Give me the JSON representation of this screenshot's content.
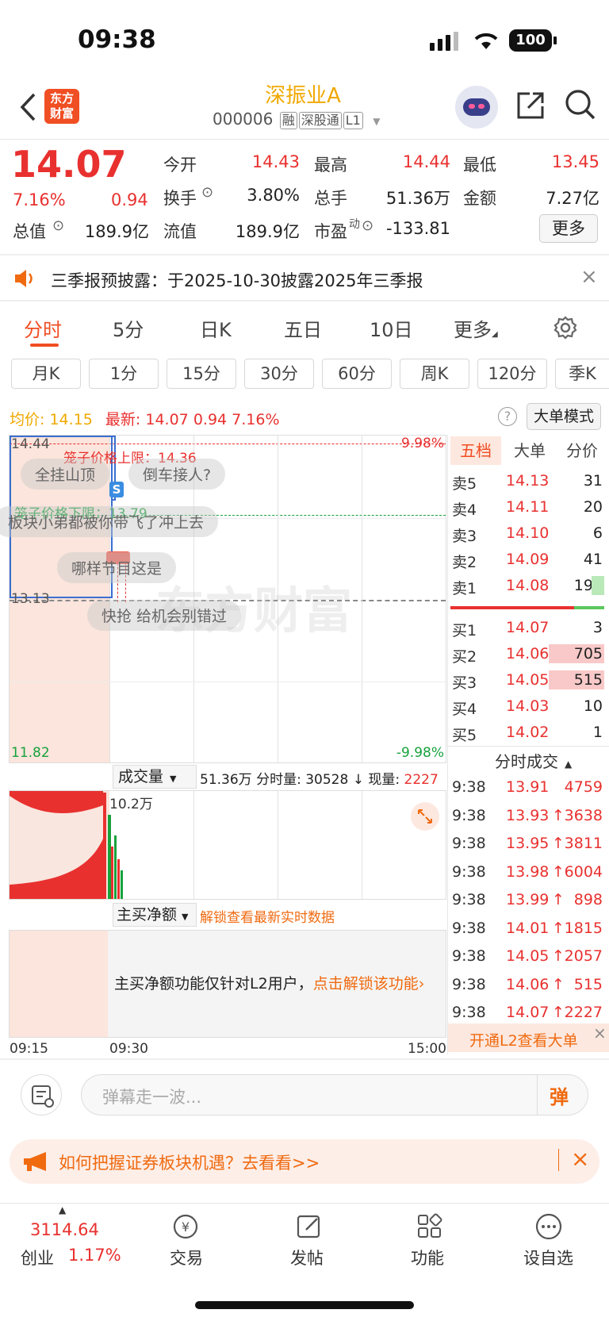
{
  "status": {
    "time": "09:38",
    "battery": "100"
  },
  "header": {
    "logo_line1": "东方",
    "logo_line2": "财富",
    "title": "深振业A",
    "code": "000006",
    "tags": [
      "融",
      "深股通",
      "L1"
    ]
  },
  "quote": {
    "price": "14.07",
    "pct": "7.16%",
    "change": "0.94",
    "rows": [
      [
        {
          "label": "今开",
          "value": "14.43",
          "color": "red"
        },
        {
          "label": "最高",
          "value": "14.44",
          "color": "red"
        },
        {
          "label": "最低",
          "value": "13.45",
          "color": "red"
        }
      ],
      [
        {
          "label": "换手",
          "value": "3.80%",
          "color": "dark"
        },
        {
          "label": "总手",
          "value": "51.36万",
          "color": "dark"
        },
        {
          "label": "金额",
          "value": "7.27亿",
          "color": "dark"
        }
      ]
    ],
    "row3": {
      "total_label": "总值",
      "total": "189.9亿",
      "float_label": "流值",
      "float": "189.9亿",
      "pe_label": "市盈",
      "pe_sup": "动",
      "pe": "-133.81"
    },
    "more": "更多"
  },
  "notice": {
    "text": "三季报预披露：于2025-10-30披露2025年三季报"
  },
  "tabs": [
    "分时",
    "5分",
    "日K",
    "五日",
    "10日",
    "更多"
  ],
  "ktabs": [
    "月K",
    "1分",
    "15分",
    "30分",
    "60分",
    "周K",
    "120分",
    "季K"
  ],
  "chartinfo": {
    "avg_label": "均价:",
    "avg": "14.15",
    "latest_label": "最新:",
    "latest": "14.07",
    "chg": "0.94",
    "pct": "7.16%",
    "bigorder": "大单模式"
  },
  "chart": {
    "high": "14.44",
    "mid": "13.13",
    "low": "11.82",
    "up_pct": "9.98%",
    "down_pct": "-9.98%",
    "cage_up": "笼子价格上限：14.36",
    "cage_down": "笼子价格下限：13.79",
    "watermark": "东方财富",
    "s_badge": "S"
  },
  "danmu": [
    "全挂山顶",
    "倒车接人?",
    "板块小弟都被你带飞了冲上去",
    "哪样节目这是",
    "快抢  给机会别错过"
  ],
  "volume": {
    "label": "成交量",
    "summary_a": "51.36万 分时量: 30528",
    "arrow": "↓",
    "summary_b": "现量:",
    "now": "2227",
    "peak": "10.2万"
  },
  "netbuy": {
    "label": "主买净额",
    "unlock": "解锁查看最新实时数据",
    "msg": "主买净额功能仅针对L2用户，",
    "link": "点击解锁该功能"
  },
  "timeaxis": [
    "09:15",
    "09:30",
    "15:00"
  ],
  "orderbook": {
    "tabs": [
      "五档",
      "大单",
      "分价"
    ],
    "asks": [
      {
        "label": "卖5",
        "price": "14.13",
        "vol": "31"
      },
      {
        "label": "卖4",
        "price": "14.11",
        "vol": "20"
      },
      {
        "label": "卖3",
        "price": "14.10",
        "vol": "6"
      },
      {
        "label": "卖2",
        "price": "14.09",
        "vol": "41"
      },
      {
        "label": "卖1",
        "price": "14.08",
        "vol": "199"
      }
    ],
    "bids": [
      {
        "label": "买1",
        "price": "14.07",
        "vol": "3"
      },
      {
        "label": "买2",
        "price": "14.06",
        "vol": "705"
      },
      {
        "label": "买3",
        "price": "14.05",
        "vol": "515"
      },
      {
        "label": "买4",
        "price": "14.03",
        "vol": "10"
      },
      {
        "label": "买5",
        "price": "14.02",
        "vol": "1"
      }
    ]
  },
  "ticks": {
    "title": "分时成交",
    "rows": [
      {
        "t": "9:38",
        "p": "13.91",
        "a": "",
        "v": "4759"
      },
      {
        "t": "9:38",
        "p": "13.93",
        "a": "↑",
        "v": "3638"
      },
      {
        "t": "9:38",
        "p": "13.95",
        "a": "↑",
        "v": "3811"
      },
      {
        "t": "9:38",
        "p": "13.98",
        "a": "↑",
        "v": "6004"
      },
      {
        "t": "9:38",
        "p": "13.99",
        "a": "↑",
        "v": "898"
      },
      {
        "t": "9:38",
        "p": "14.01",
        "a": "↑",
        "v": "1815"
      },
      {
        "t": "9:38",
        "p": "14.05",
        "a": "↑",
        "v": "2057"
      },
      {
        "t": "9:38",
        "p": "14.06",
        "a": "↑",
        "v": "515"
      },
      {
        "t": "9:38",
        "p": "14.07",
        "a": "↑",
        "v": "2227"
      }
    ],
    "l2": "开通L2查看大单"
  },
  "comment": {
    "placeholder": "弹幕走一波...",
    "send": "弹"
  },
  "banner": {
    "text": "如何把握证券板块机遇？去看看>>"
  },
  "nav": {
    "index_value": "3114.64",
    "index_name": "创业",
    "index_pct": "1.17%",
    "items": [
      "交易",
      "发帖",
      "功能",
      "设自选"
    ]
  }
}
